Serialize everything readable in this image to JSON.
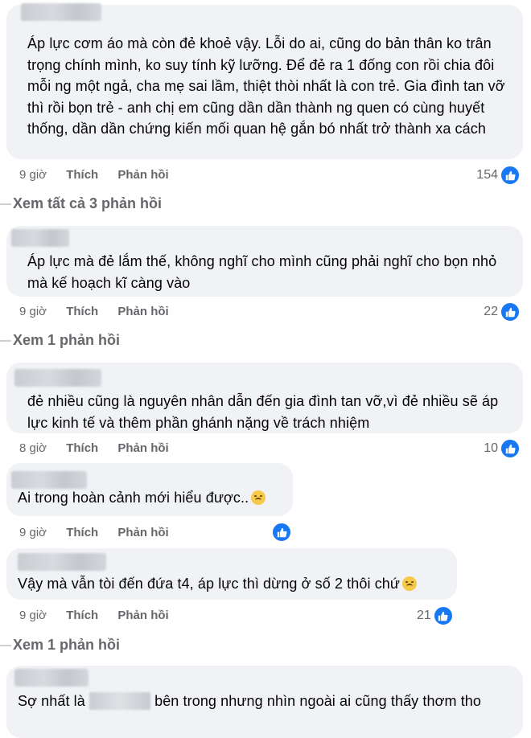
{
  "comments": [
    {
      "text": "Áp lực cơm áo mà còn đẻ khoẻ vậy. Lỗi do ai, cũng do bản thân ko trân trọng chính mình, ko suy tính kỹ lưỡng. Để đẻ ra 1 đống con rồi chia đôi mỗi ng một ngả, cha mẹ sai lầm, thiệt thòi nhất là con trẻ. Gia đình tan vỡ thì rồi bọn trẻ - anh chị em cũng dần dần thành ng quen có cùng huyết thống, dần dần chứng kiến mối quan hệ gắn bó nhất trở thành xa cách",
      "time": "9 giờ",
      "like": "Thích",
      "reply": "Phản hồi",
      "reactions": "154"
    },
    {
      "text": "Áp lực mà đẻ lắm thế, không nghĩ cho mình cũng phải nghĩ cho bọn nhỏ mà kế hoạch kĩ càng vào",
      "time": "9 giờ",
      "like": "Thích",
      "reply": "Phản hồi",
      "reactions": "22"
    },
    {
      "text": "đẻ nhiều cũng là nguyên nhân dẫn đến gia đình tan vỡ,vì đẻ nhiều sẽ áp lực kinh tế và thêm phần ghánh nặng về trách nhiệm",
      "time": "8 giờ",
      "like": "Thích",
      "reply": "Phản hồi",
      "reactions": "10"
    },
    {
      "text": "Ai trong hoàn cảnh mới hiểu được..",
      "time": "9 giờ",
      "like": "Thích",
      "reply": "Phản hồi",
      "reactions": ""
    },
    {
      "text": "Vậy mà vẫn tòi đến đứa t4, áp lực thì dừng ở số 2 thôi chứ",
      "time": "9 giờ",
      "like": "Thích",
      "reply": "Phản hồi",
      "reactions": "21"
    },
    {
      "text_before": "Sợ nhất là",
      "text_after": "bên trong nhưng nhìn ngoài ai cũng thấy thơm tho"
    }
  ],
  "view_replies": [
    "Xem tất cả 3 phản hồi",
    "Xem 1 phản hồi",
    "Xem 1 phản hồi"
  ],
  "icons": {
    "like": "thumbs-up-icon",
    "emoji_sad": "sad-face-emoji",
    "emoji_worried": "worried-face-emoji"
  },
  "colors": {
    "bubble": "#f0f2f5",
    "meta": "#65676b",
    "like_blue": "#1877f2"
  }
}
